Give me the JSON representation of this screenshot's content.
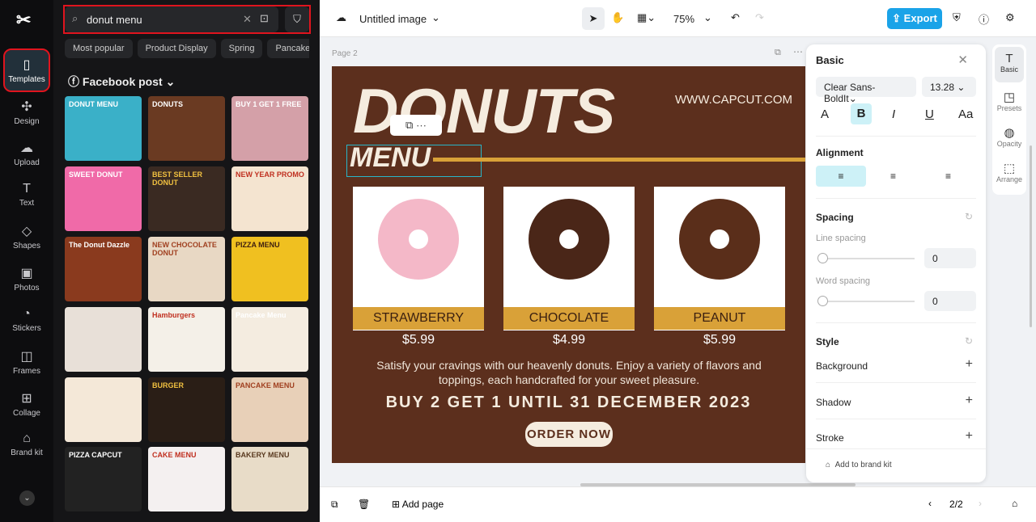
{
  "rail": {
    "items": [
      {
        "label": "Templates",
        "icon": "templates-icon"
      },
      {
        "label": "Design",
        "icon": "design-icon"
      },
      {
        "label": "Upload",
        "icon": "upload-icon"
      },
      {
        "label": "Text",
        "icon": "text-icon"
      },
      {
        "label": "Shapes",
        "icon": "shapes-icon"
      },
      {
        "label": "Photos",
        "icon": "photos-icon"
      },
      {
        "label": "Stickers",
        "icon": "stickers-icon"
      },
      {
        "label": "Frames",
        "icon": "frames-icon"
      },
      {
        "label": "Collage",
        "icon": "collage-icon"
      },
      {
        "label": "Brand kit",
        "icon": "brand-kit-icon"
      }
    ]
  },
  "panel": {
    "search_value": "donut menu",
    "chips": [
      "Most popular",
      "Product Display",
      "Spring",
      "Pancake"
    ],
    "section": "Facebook post",
    "templates": [
      "DONUT MENU",
      "DONUTS",
      "BUY 1 GET 1 FREE",
      "SWEET DONUT",
      "BEST SELLER DONUT",
      "NEW YEAR PROMO",
      "The Donut Dazzle",
      "NEW CHOCOLATE DONUT",
      "PIZZA MENU",
      "",
      "Hamburgers",
      "Pancake Menu",
      "",
      "BURGER",
      "PANCAKE MENU",
      "PIZZA CAPCUT",
      "CAKE MENU",
      "BAKERY MENU"
    ]
  },
  "topbar": {
    "title": "Untitled image",
    "zoom": "75%",
    "export": "Export"
  },
  "canvas": {
    "page_label": "Page 2",
    "design": {
      "headline": "DONUTS",
      "subhead": "MENU",
      "website": "WWW.CAPCUT.COM",
      "products": [
        {
          "name": "STRAWBERRY",
          "price": "$5.99"
        },
        {
          "name": "CHOCOLATE",
          "price": "$4.99"
        },
        {
          "name": "PEANUT",
          "price": "$5.99"
        }
      ],
      "tagline": "Satisfy your cravings with our heavenly donuts. Enjoy a variety of flavors and toppings, each handcrafted for your sweet pleasure.",
      "promo": "BUY 2 GET 1 UNTIL 31 DECEMBER 2023",
      "cta": "ORDER NOW"
    }
  },
  "props": {
    "title": "Basic",
    "font": "Clear Sans-BoldIt",
    "size": "13.28",
    "alignment": "Alignment",
    "spacing": "Spacing",
    "line_spacing": "Line spacing",
    "line_value": "0",
    "word_spacing": "Word spacing",
    "word_value": "0",
    "style": "Style",
    "background": "Background",
    "shadow": "Shadow",
    "stroke": "Stroke",
    "brand": "Add to brand kit"
  },
  "side": [
    {
      "label": "Basic"
    },
    {
      "label": "Presets"
    },
    {
      "label": "Opacity"
    },
    {
      "label": "Arrange"
    }
  ],
  "bottom": {
    "add_page": "Add page",
    "pages": "2/2"
  },
  "colors": {
    "accent": "#1aa3e8",
    "design_bg": "#5c2f1d",
    "gold": "#d9a138"
  }
}
